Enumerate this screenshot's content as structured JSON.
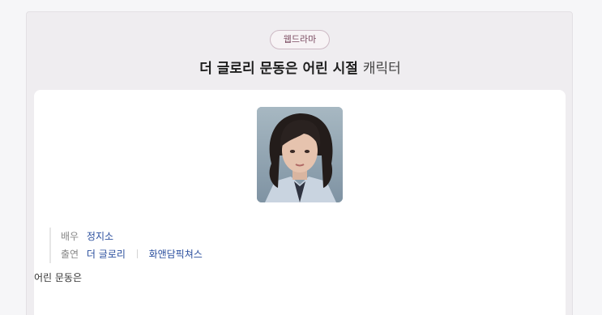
{
  "badge": "웹드라마",
  "title": {
    "bold": "더 글로리 문동은 어린 시절",
    "suffix": "캐릭터"
  },
  "profile": {
    "photo_alt": "어린 문동은 프로필 사진",
    "actor_label": "배우",
    "actor_name": "정지소",
    "appearance_label": "출연",
    "appearances": [
      "더 글로리",
      "화앤담픽쳐스"
    ]
  },
  "description": "어린 문동은"
}
